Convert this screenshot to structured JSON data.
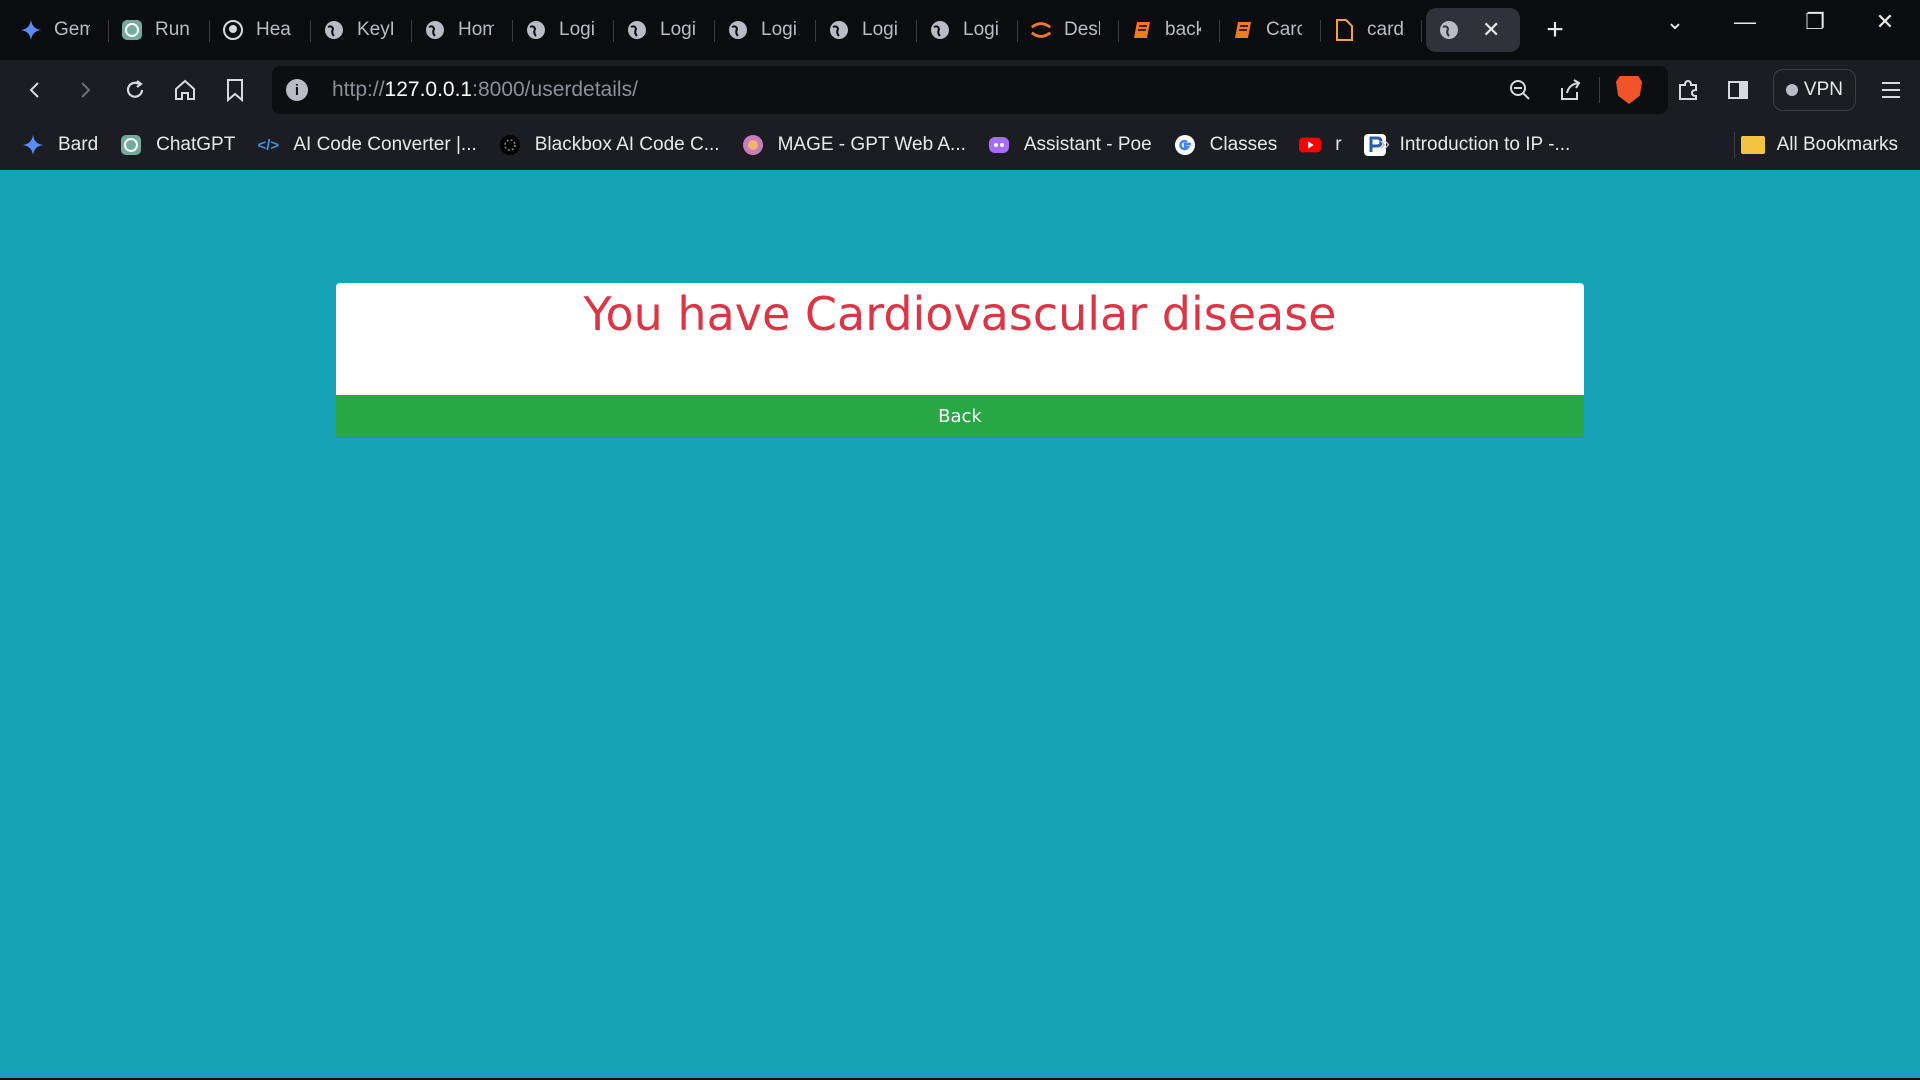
{
  "browser": {
    "tabs": [
      {
        "label": "Gem",
        "icon": "gemini-sparkle-icon"
      },
      {
        "label": "Run",
        "icon": "chatgpt-icon"
      },
      {
        "label": "Hear",
        "icon": "github-icon"
      },
      {
        "label": "KeyE",
        "icon": "globe-icon"
      },
      {
        "label": "Hom",
        "icon": "globe-icon"
      },
      {
        "label": "Logi",
        "icon": "globe-icon"
      },
      {
        "label": "Logi",
        "icon": "globe-icon"
      },
      {
        "label": "Logi",
        "icon": "globe-icon"
      },
      {
        "label": "Logi",
        "icon": "globe-icon"
      },
      {
        "label": "Logi",
        "icon": "globe-icon"
      },
      {
        "label": "Desl",
        "icon": "jupyter-icon"
      },
      {
        "label": "back",
        "icon": "notebook-icon"
      },
      {
        "label": "Carc",
        "icon": "notebook-icon"
      },
      {
        "label": "card",
        "icon": "file-icon"
      }
    ],
    "active_tab_icon": "globe-icon",
    "url_scheme": "http://",
    "url_host": "127.0.0.1",
    "url_rest": ":8000/userdetails/",
    "vpn_label": "VPN"
  },
  "bookmarks": [
    {
      "label": "Bard",
      "icon": "bard-sparkle-icon"
    },
    {
      "label": "ChatGPT",
      "icon": "chatgpt-icon"
    },
    {
      "label": "AI Code Converter |...",
      "icon": "code-icon"
    },
    {
      "label": "Blackbox AI Code C...",
      "icon": "blackbox-icon"
    },
    {
      "label": "MAGE - GPT Web A...",
      "icon": "mage-icon"
    },
    {
      "label": "Assistant - Poe",
      "icon": "poe-icon"
    },
    {
      "label": "Classes",
      "icon": "google-icon"
    },
    {
      "label": "r",
      "icon": "youtube-icon"
    },
    {
      "label": "Introduction to IP -...",
      "icon": "p-icon"
    }
  ],
  "bookmarks_more": "»",
  "all_bookmarks_label": "All Bookmarks",
  "page": {
    "result_text": "You have Cardiovascular disease",
    "back_label": "Back"
  },
  "colors": {
    "page_bg": "#17a2b8",
    "result_text": "#dc3545",
    "back_button": "#28a745"
  }
}
